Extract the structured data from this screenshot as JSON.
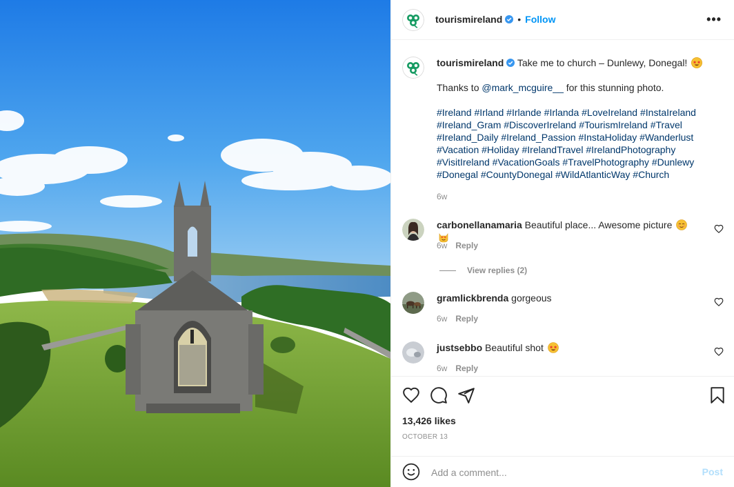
{
  "post": {
    "username": "tourismireland",
    "follow_label": "Follow",
    "separator": "•",
    "more_label": "•••",
    "caption": {
      "text": "Take me to church – Dunlewy, Donegal!",
      "thanks_prefix": "Thanks to",
      "mention": "@mark_mcguire__",
      "thanks_suffix": "for this stunning photo.",
      "hashtags": "#Ireland #Irland #Irlande #Irlanda #LoveIreland #InstaIreland #Ireland_Gram #DiscoverIreland #TourismIreland #Travel #Ireland_Daily #Ireland_Passion #InstaHoliday #Wanderlust #Vacation #Holiday #IrelandTravel #IrelandPhotography #VisitIreland #VacationGoals #TravelPhotography #Dunlewy #Donegal #CountyDonegal #WildAtlanticWay #Church",
      "age": "6w"
    },
    "comments": [
      {
        "username": "carbonellanamaria",
        "text": "Beautiful place... Awesome picture",
        "age": "6w",
        "reply_label": "Reply",
        "view_replies": "View replies (2)"
      },
      {
        "username": "gramlickbrenda",
        "text": "gorgeous",
        "age": "6w",
        "reply_label": "Reply"
      },
      {
        "username": "justsebbo",
        "text": "Beautiful shot",
        "age": "6w",
        "reply_label": "Reply"
      }
    ],
    "likes": "13,426 likes",
    "date": "OCTOBER 13",
    "add_comment": {
      "placeholder": "Add a comment...",
      "post_label": "Post"
    }
  },
  "colors": {
    "link": "#0095f6",
    "hashtag": "#00376b",
    "muted": "#8e8e8e",
    "brand_green": "#169b62"
  }
}
